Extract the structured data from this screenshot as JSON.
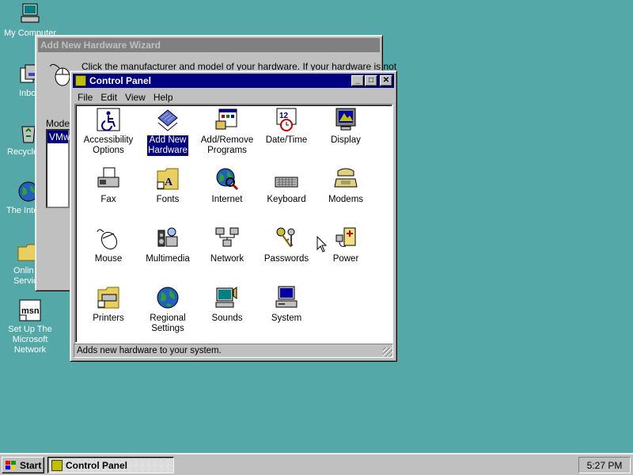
{
  "desktop": {
    "icons": [
      {
        "label": "My Computer",
        "icon": "my-computer-icon"
      },
      {
        "label": "Inbox",
        "icon": "inbox-icon"
      },
      {
        "label": "Recycle Bin",
        "icon": "recycle-bin-icon"
      },
      {
        "label": "The Internet",
        "icon": "internet-icon"
      },
      {
        "label": "Online\nServices",
        "icon": "folder-icon"
      },
      {
        "label": "Set Up The\nMicrosoft\nNetwork",
        "icon": "msn-icon"
      }
    ]
  },
  "wizard": {
    "title": "Add New Hardware Wizard",
    "instruction": "Click the manufacturer and model of your hardware. If your hardware is not",
    "model_label": "Model",
    "selected_model": "VMwa"
  },
  "control_panel": {
    "title": "Control Panel",
    "menu": [
      "File",
      "Edit",
      "View",
      "Help"
    ],
    "items": [
      {
        "label": "Accessibility\nOptions",
        "icon": "accessibility-icon"
      },
      {
        "label": "Add New\nHardware",
        "icon": "add-hardware-icon"
      },
      {
        "label": "Add/Remove\nPrograms",
        "icon": "add-remove-programs-icon"
      },
      {
        "label": "Date/Time",
        "icon": "date-time-icon"
      },
      {
        "label": "Display",
        "icon": "display-icon"
      },
      {
        "label": "Fax",
        "icon": "fax-icon"
      },
      {
        "label": "Fonts",
        "icon": "fonts-icon"
      },
      {
        "label": "Internet",
        "icon": "internet-icon"
      },
      {
        "label": "Keyboard",
        "icon": "keyboard-icon"
      },
      {
        "label": "Modems",
        "icon": "modem-icon"
      },
      {
        "label": "Mouse",
        "icon": "mouse-icon"
      },
      {
        "label": "Multimedia",
        "icon": "multimedia-icon"
      },
      {
        "label": "Network",
        "icon": "network-icon"
      },
      {
        "label": "Passwords",
        "icon": "passwords-icon"
      },
      {
        "label": "Power",
        "icon": "power-icon"
      },
      {
        "label": "Printers",
        "icon": "printers-icon"
      },
      {
        "label": "Regional\nSettings",
        "icon": "regional-settings-icon"
      },
      {
        "label": "Sounds",
        "icon": "sounds-icon"
      },
      {
        "label": "System",
        "icon": "system-icon"
      }
    ],
    "selected_item": "Add New\nHardware",
    "status": "Adds new hardware to your system."
  },
  "taskbar": {
    "start_label": "Start",
    "task_label": "Control Panel",
    "clock": "5:27 PM"
  },
  "colors": {
    "desktop": "#55a8a8",
    "active_title": "#000080",
    "inactive_title": "#808080",
    "face": "#c0c0c0"
  }
}
